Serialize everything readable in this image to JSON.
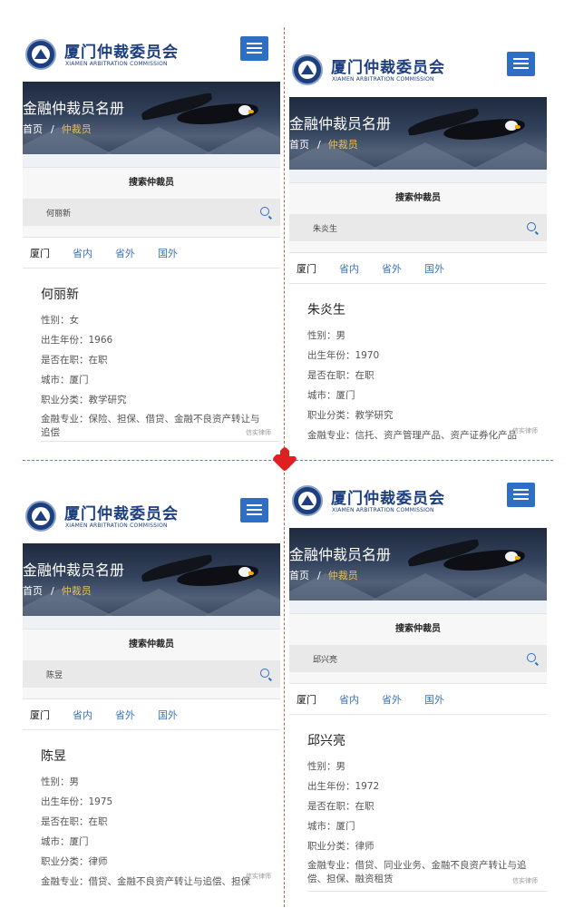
{
  "header": {
    "org_cn": "厦门仲裁委员会",
    "org_en": "XIAMEN ARBITRATION COMMISSION"
  },
  "banner": {
    "title": "金融仲裁员名册",
    "crumb_home": "首页",
    "crumb_sep": "/",
    "crumb_current": "仲裁员"
  },
  "search": {
    "title": "搜索仲裁员"
  },
  "tabs": [
    "厦门",
    "省内",
    "省外",
    "国外"
  ],
  "labels": {
    "gender": "性别：",
    "birth": "出生年份：",
    "inservice": "是否在职：",
    "city": "城市：",
    "category": "职业分类：",
    "specialty": "金融专业："
  },
  "watermark": "信实律师",
  "panels": [
    {
      "query": "何丽新",
      "name": "何丽新",
      "gender": "女",
      "birth": "1966",
      "inservice": "在职",
      "city": "厦门",
      "category": "教学研究",
      "specialty": "保险、担保、借贷、金融不良资产转让与追偿"
    },
    {
      "query": "朱炎生",
      "name": "朱炎生",
      "gender": "男",
      "birth": "1970",
      "inservice": "在职",
      "city": "厦门",
      "category": "教学研究",
      "specialty": "信托、资产管理产品、资产证券化产品"
    },
    {
      "query": "陈昱",
      "name": "陈昱",
      "gender": "男",
      "birth": "1975",
      "inservice": "在职",
      "city": "厦门",
      "category": "律师",
      "specialty": "借贷、金融不良资产转让与追偿、担保"
    },
    {
      "query": "邱兴亮",
      "name": "邱兴亮",
      "gender": "男",
      "birth": "1972",
      "inservice": "在职",
      "city": "厦门",
      "category": "律师",
      "specialty": "借贷、同业业务、金融不良资产转让与追偿、担保、融资租赁"
    }
  ]
}
